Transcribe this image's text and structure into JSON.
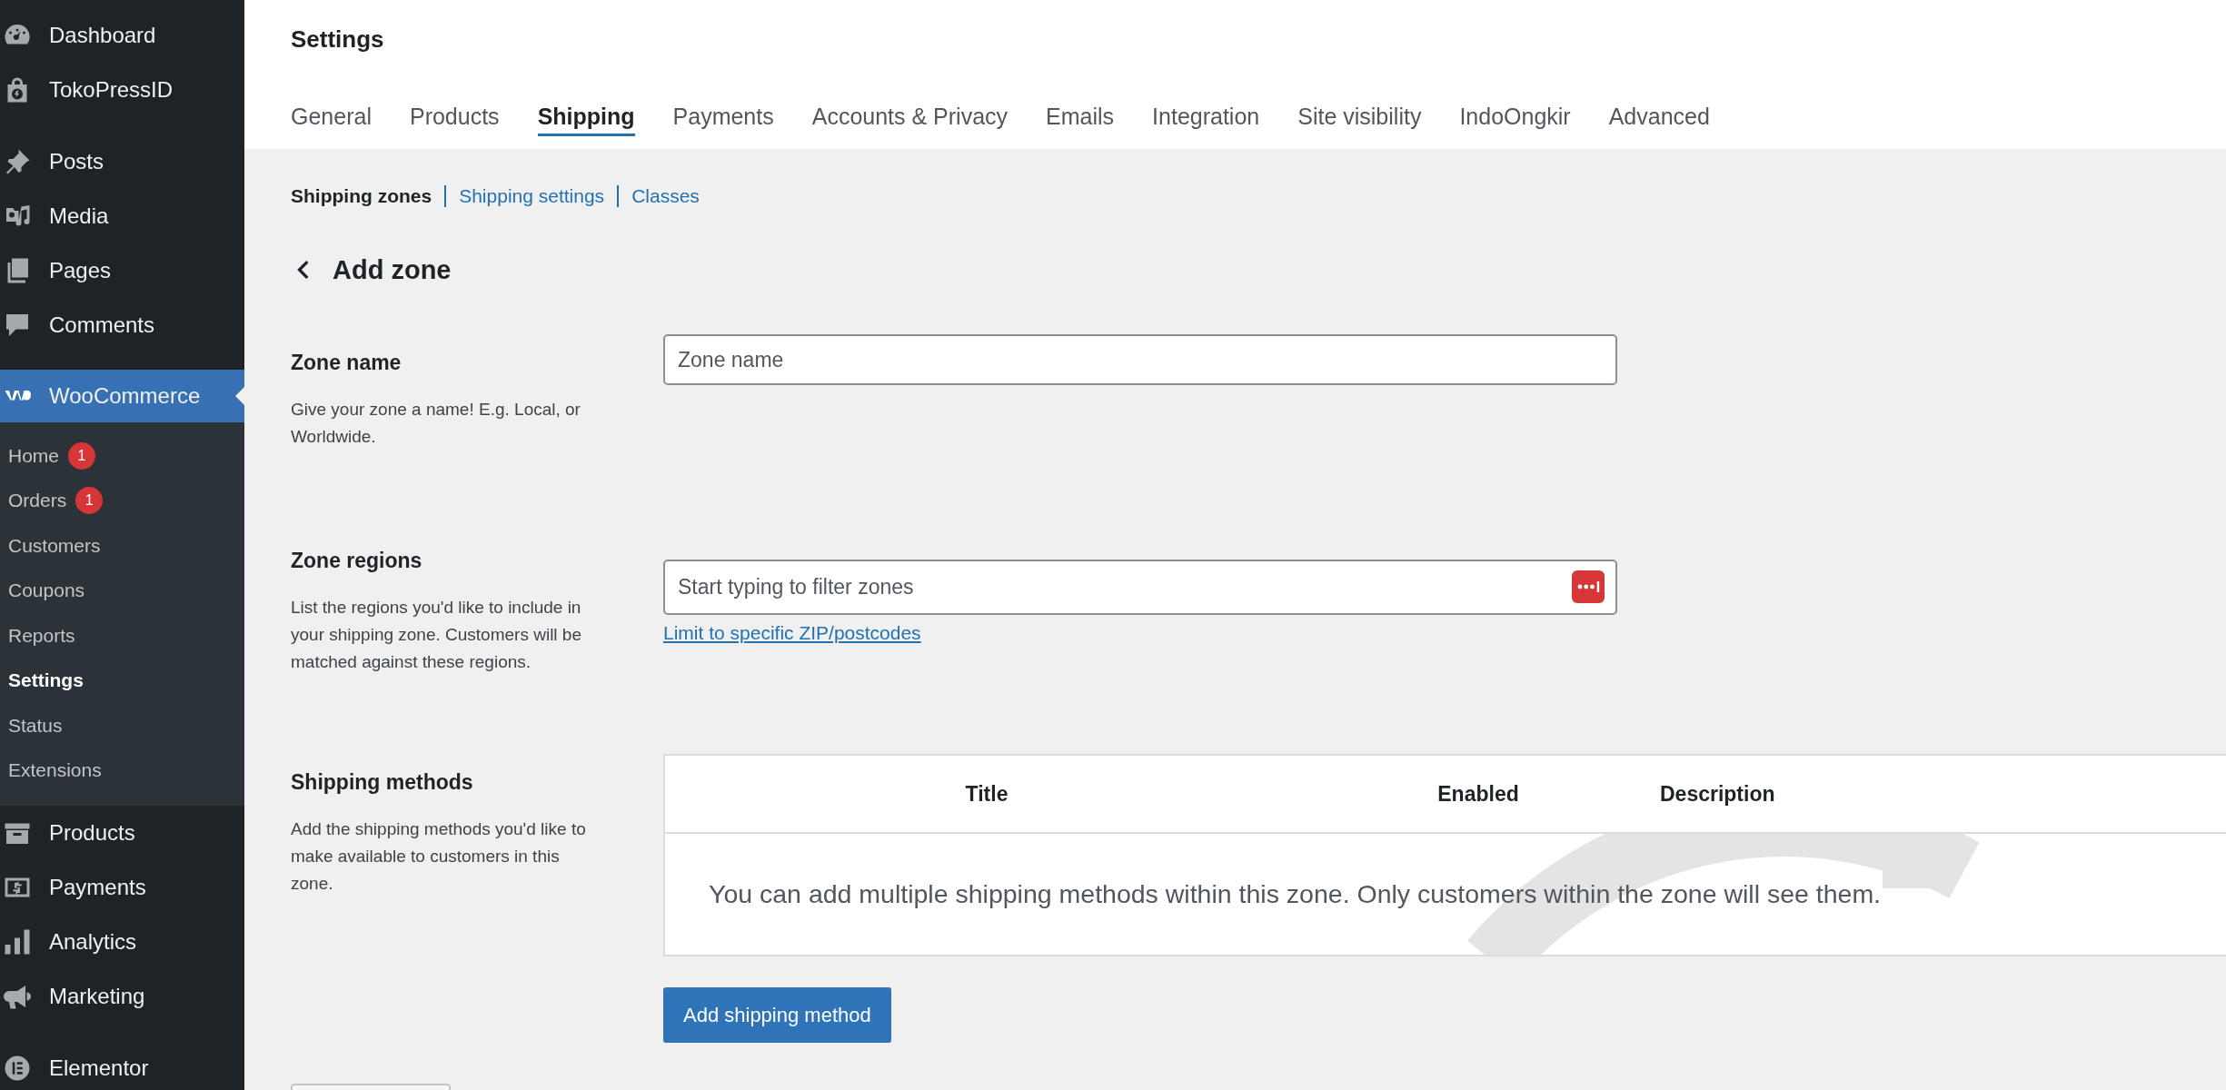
{
  "sidebar": {
    "sections": [
      [
        {
          "label": "Dashboard",
          "selected": false
        },
        {
          "label": "TokoPressID",
          "selected": false
        }
      ],
      [
        {
          "label": "Posts",
          "selected": false
        },
        {
          "label": "Media",
          "selected": false
        },
        {
          "label": "Pages",
          "selected": false
        },
        {
          "label": "Comments",
          "selected": false
        }
      ],
      [
        {
          "label": "WooCommerce",
          "selected": true,
          "children": [
            {
              "label": "Home",
              "selected": false,
              "badge": "1"
            },
            {
              "label": "Orders",
              "selected": false,
              "badge": "1"
            },
            {
              "label": "Customers",
              "selected": false
            },
            {
              "label": "Coupons",
              "selected": false
            },
            {
              "label": "Reports",
              "selected": false
            },
            {
              "label": "Settings",
              "selected": true
            },
            {
              "label": "Status",
              "selected": false
            },
            {
              "label": "Extensions",
              "selected": false
            }
          ]
        },
        {
          "label": "Products",
          "selected": false
        },
        {
          "label": "Payments",
          "selected": false
        },
        {
          "label": "Analytics",
          "selected": false
        },
        {
          "label": "Marketing",
          "selected": false
        }
      ],
      [
        {
          "label": "Elementor",
          "selected": false
        }
      ]
    ]
  },
  "page": {
    "title": "Settings",
    "tabs": [
      {
        "label": "General",
        "selected": false
      },
      {
        "label": "Products",
        "selected": false
      },
      {
        "label": "Shipping",
        "selected": true
      },
      {
        "label": "Payments",
        "selected": false
      },
      {
        "label": "Accounts & Privacy",
        "selected": false
      },
      {
        "label": "Emails",
        "selected": false
      },
      {
        "label": "Integration",
        "selected": false
      },
      {
        "label": "Site visibility",
        "selected": false
      },
      {
        "label": "IndoOngkir",
        "selected": false
      },
      {
        "label": "Advanced",
        "selected": false
      }
    ],
    "subnav": [
      {
        "label": "Shipping zones",
        "selected": true
      },
      {
        "label": "Shipping settings",
        "selected": false
      },
      {
        "label": "Classes",
        "selected": false
      }
    ],
    "back_heading": "Add zone",
    "sections": [
      {
        "kind": "text-field",
        "title": "Zone name",
        "description": "Give your zone a name! E.g. Local, or Worldwide.",
        "placeholder": "Zone name"
      },
      {
        "kind": "region-field",
        "title": "Zone regions",
        "description": "List the regions you'd like to include in your shipping zone. Customers will be matched against these regions.",
        "placeholder": "Start typing to filter zones",
        "link": "Limit to specific ZIP/postcodes"
      },
      {
        "kind": "methods-table",
        "title": "Shipping methods",
        "description": "Add the shipping methods you'd like to make available to customers in this zone.",
        "columns": [
          "Title",
          "Enabled",
          "Description"
        ],
        "empty_message": "You can add multiple shipping methods within this zone. Only customers within the zone will see them.",
        "button": "Add shipping method"
      }
    ]
  }
}
